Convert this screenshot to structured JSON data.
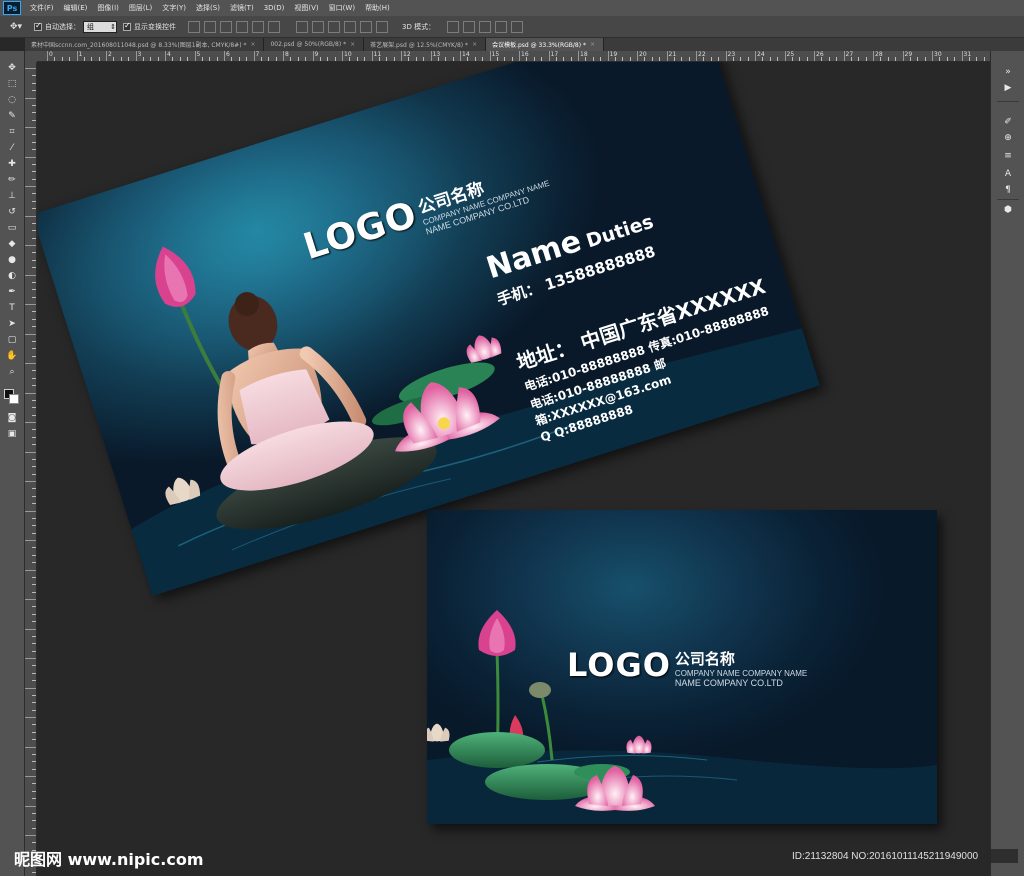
{
  "app": {
    "logo": "Ps",
    "menu": [
      "文件(F)",
      "编辑(E)",
      "图像(I)",
      "图层(L)",
      "文字(Y)",
      "选择(S)",
      "滤镜(T)",
      "3D(D)",
      "视图(V)",
      "窗口(W)",
      "帮助(H)"
    ]
  },
  "options_bar": {
    "auto_select_label": "自动选择：",
    "auto_select_value": "组",
    "show_transform_label": "显示变换控件",
    "mode_3d_label": "3D 模式："
  },
  "tabs": [
    {
      "label": "素材中国sccnn.com_201608011048.psd @ 8.33%(图层1副本, CMYK/8#) *",
      "active": false
    },
    {
      "label": "002.psd @ 50%(RGB/8) *",
      "active": false
    },
    {
      "label": "茶艺展架.psd @ 12.5%(CMYK/8) *",
      "active": false
    },
    {
      "label": "会议模板.psd @ 33.3%(RGB/8) *",
      "active": true
    }
  ],
  "tab_close": "×",
  "ruler_labels": [
    "0",
    "1",
    "2",
    "3",
    "4",
    "5",
    "6",
    "7",
    "8",
    "9",
    "10",
    "11",
    "12",
    "13",
    "14",
    "15",
    "16",
    "17",
    "18",
    "19",
    "20",
    "21",
    "22",
    "23",
    "24",
    "25",
    "26",
    "27",
    "28",
    "29",
    "30",
    "31",
    "32"
  ],
  "card_front": {
    "logo": "LOGO",
    "company_cn": "公司名称",
    "company_en_1": "COMPANY NAME COMPANY NAME",
    "company_en_2": "NAME COMPANY CO.LTD",
    "name": "Name",
    "duties": "Duties",
    "mobile": "手机：  13588888888",
    "address": "地址：  中国广东省XXXXXX",
    "phone": "电话:010-88888888  传真:010-88888888",
    "email": "电话:010-88888888  邮箱:XXXXXX@163.com",
    "qq": "Q Q:88888888"
  },
  "card_back": {
    "logo": "LOGO",
    "company_cn": "公司名称",
    "company_en_1": "COMPANY NAME COMPANY NAME",
    "company_en_2": "NAME COMPANY CO.LTD"
  },
  "watermark": {
    "site": "昵图网 www.nipic.com",
    "id": "ID:21132804 NO:20161011145211949000"
  },
  "colors": {
    "chrome": "#535353",
    "canvas": "#282828",
    "card_dark": "#0c2337",
    "card_teal": "#1d6d86",
    "lotus_pink": "#e86aa8",
    "leaf_green": "#2f8f5a"
  },
  "icons": {
    "toolbox": [
      "move-icon",
      "marquee-icon",
      "lasso-icon",
      "quick-select-icon",
      "crop-icon",
      "eyedropper-icon",
      "healing-icon",
      "brush-icon",
      "stamp-icon",
      "history-brush-icon",
      "eraser-icon",
      "bucket-icon",
      "blur-icon",
      "dodge-icon",
      "pen-icon",
      "type-icon",
      "path-select-icon",
      "shape-icon",
      "hand-icon",
      "zoom-icon"
    ],
    "right_panel": [
      "panel-collapse-icon",
      "play-icon",
      "brush-preset-icon",
      "clone-source-icon",
      "adjust-icon",
      "character-icon",
      "paragraph-icon",
      "3d-icon"
    ]
  }
}
